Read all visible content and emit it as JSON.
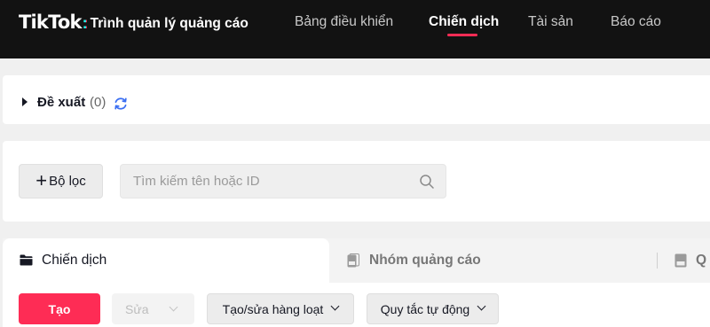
{
  "header": {
    "logo_text": "TikTok",
    "logo_colon": ":",
    "app_title": "Trình quản lý quảng cáo",
    "nav": [
      {
        "label": "Bảng điều khiển",
        "active": false
      },
      {
        "label": "Chiến dịch",
        "active": true
      },
      {
        "label": "Tài sản",
        "active": false
      },
      {
        "label": "Báo cáo",
        "active": false
      }
    ],
    "accent_color": "#fe2c55"
  },
  "suggestions": {
    "label": "Đề xuất",
    "count": "(0)",
    "icon": "refresh-icon"
  },
  "filter": {
    "plus": "+",
    "button_label": "Bộ lọc",
    "search_placeholder": "Tìm kiếm tên hoặc ID",
    "search_value": "",
    "search_icon": "search-icon"
  },
  "tabs": [
    {
      "label": "Chiến dịch",
      "active": true,
      "icon": "folder-icon"
    },
    {
      "label": "Nhóm quảng cáo",
      "active": false,
      "icon": "ad-group-icon"
    },
    {
      "label": "Q",
      "active": false,
      "icon": "ad-icon"
    }
  ],
  "toolbar": {
    "create_label": "Tạo",
    "edit_label": "Sửa",
    "bulk_label": "Tạo/sửa hàng loạt",
    "rules_label": "Quy tắc tự động"
  }
}
